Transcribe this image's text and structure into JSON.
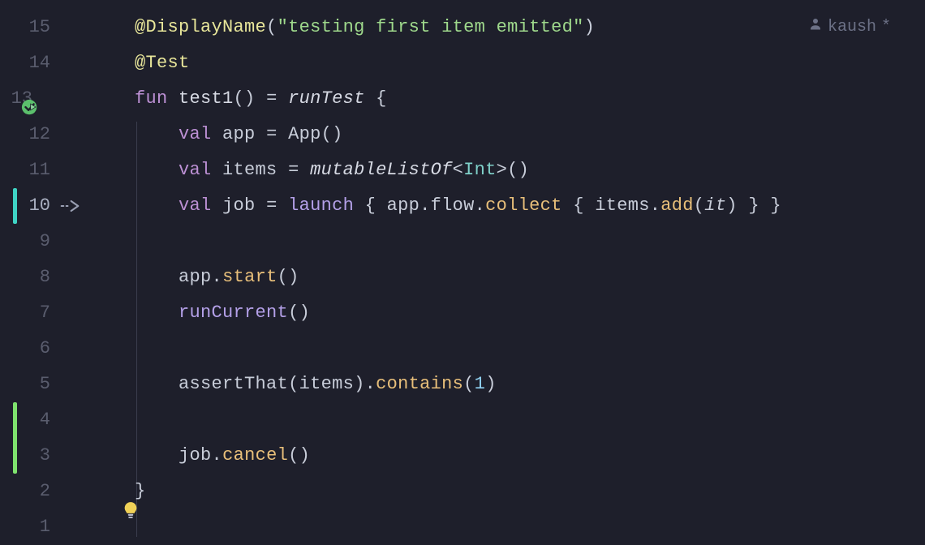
{
  "author_hint": {
    "name": "kaush",
    "dirty": "*"
  },
  "gutter": {
    "lines": [
      {
        "n": "15"
      },
      {
        "n": "14"
      },
      {
        "n": "13",
        "run_test": true
      },
      {
        "n": "12"
      },
      {
        "n": "11"
      },
      {
        "n": "10",
        "diff": true,
        "vcs": "teal",
        "current": true
      },
      {
        "n": "9"
      },
      {
        "n": "8"
      },
      {
        "n": "7"
      },
      {
        "n": "6"
      },
      {
        "n": "5"
      },
      {
        "n": "4",
        "vcs": "green"
      },
      {
        "n": "3",
        "vcs": "green"
      },
      {
        "n": "2"
      },
      {
        "n": "1",
        "bulb": true
      }
    ]
  },
  "code": {
    "l15": {
      "indent": "    ",
      "ann": "@DisplayName",
      "open": "(",
      "str": "\"testing first item emitted\"",
      "close": ")"
    },
    "l14": {
      "indent": "    ",
      "ann": "@Test"
    },
    "l13": {
      "indent": "    ",
      "kw": "fun ",
      "name": "test1",
      "parens": "()",
      "eq": " = ",
      "call": "runTest ",
      "brace": "{"
    },
    "l12": {
      "indent": "        ",
      "kw": "val ",
      "name": "app",
      "eq": " = ",
      "ctor": "App()"
    },
    "l11": {
      "indent": "        ",
      "kw": "val ",
      "name": "items",
      "eq": " = ",
      "call": "mutableListOf",
      "lt": "<",
      "type": "Int",
      "gt": ">",
      "parens": "()"
    },
    "l10": {
      "indent": "        ",
      "kw": "val ",
      "name": "job",
      "eq": " = ",
      "launch": "launch ",
      "ob": "{ ",
      "obj1": "app",
      "dot1": ".",
      "flow": "flow",
      "dot2": ".",
      "collect": "collect ",
      "ob2": "{ ",
      "items": "items",
      "dot3": ".",
      "add": "add",
      "open": "(",
      "it": "it",
      "close": ")",
      "cb2": " } ",
      "cb": "}"
    },
    "l9": {
      "indent": ""
    },
    "l8": {
      "indent": "        ",
      "obj": "app",
      "dot": ".",
      "meth": "start",
      "parens": "()"
    },
    "l7": {
      "indent": "        ",
      "call": "runCurrent",
      "parens": "()"
    },
    "l6": {
      "indent": ""
    },
    "l5": {
      "indent": "        ",
      "assert": "assertThat",
      "open1": "(",
      "arg1": "items",
      "close1": ")",
      "dot": ".",
      "contains": "contains",
      "open2": "(",
      "num": "1",
      "close2": ")"
    },
    "l4": {
      "indent": ""
    },
    "l3": {
      "indent": "        ",
      "obj": "job",
      "dot": ".",
      "meth": "cancel",
      "parens": "()"
    },
    "l2": {
      "indent": "    ",
      "brace": "}"
    },
    "l1": {
      "indent": ""
    }
  }
}
